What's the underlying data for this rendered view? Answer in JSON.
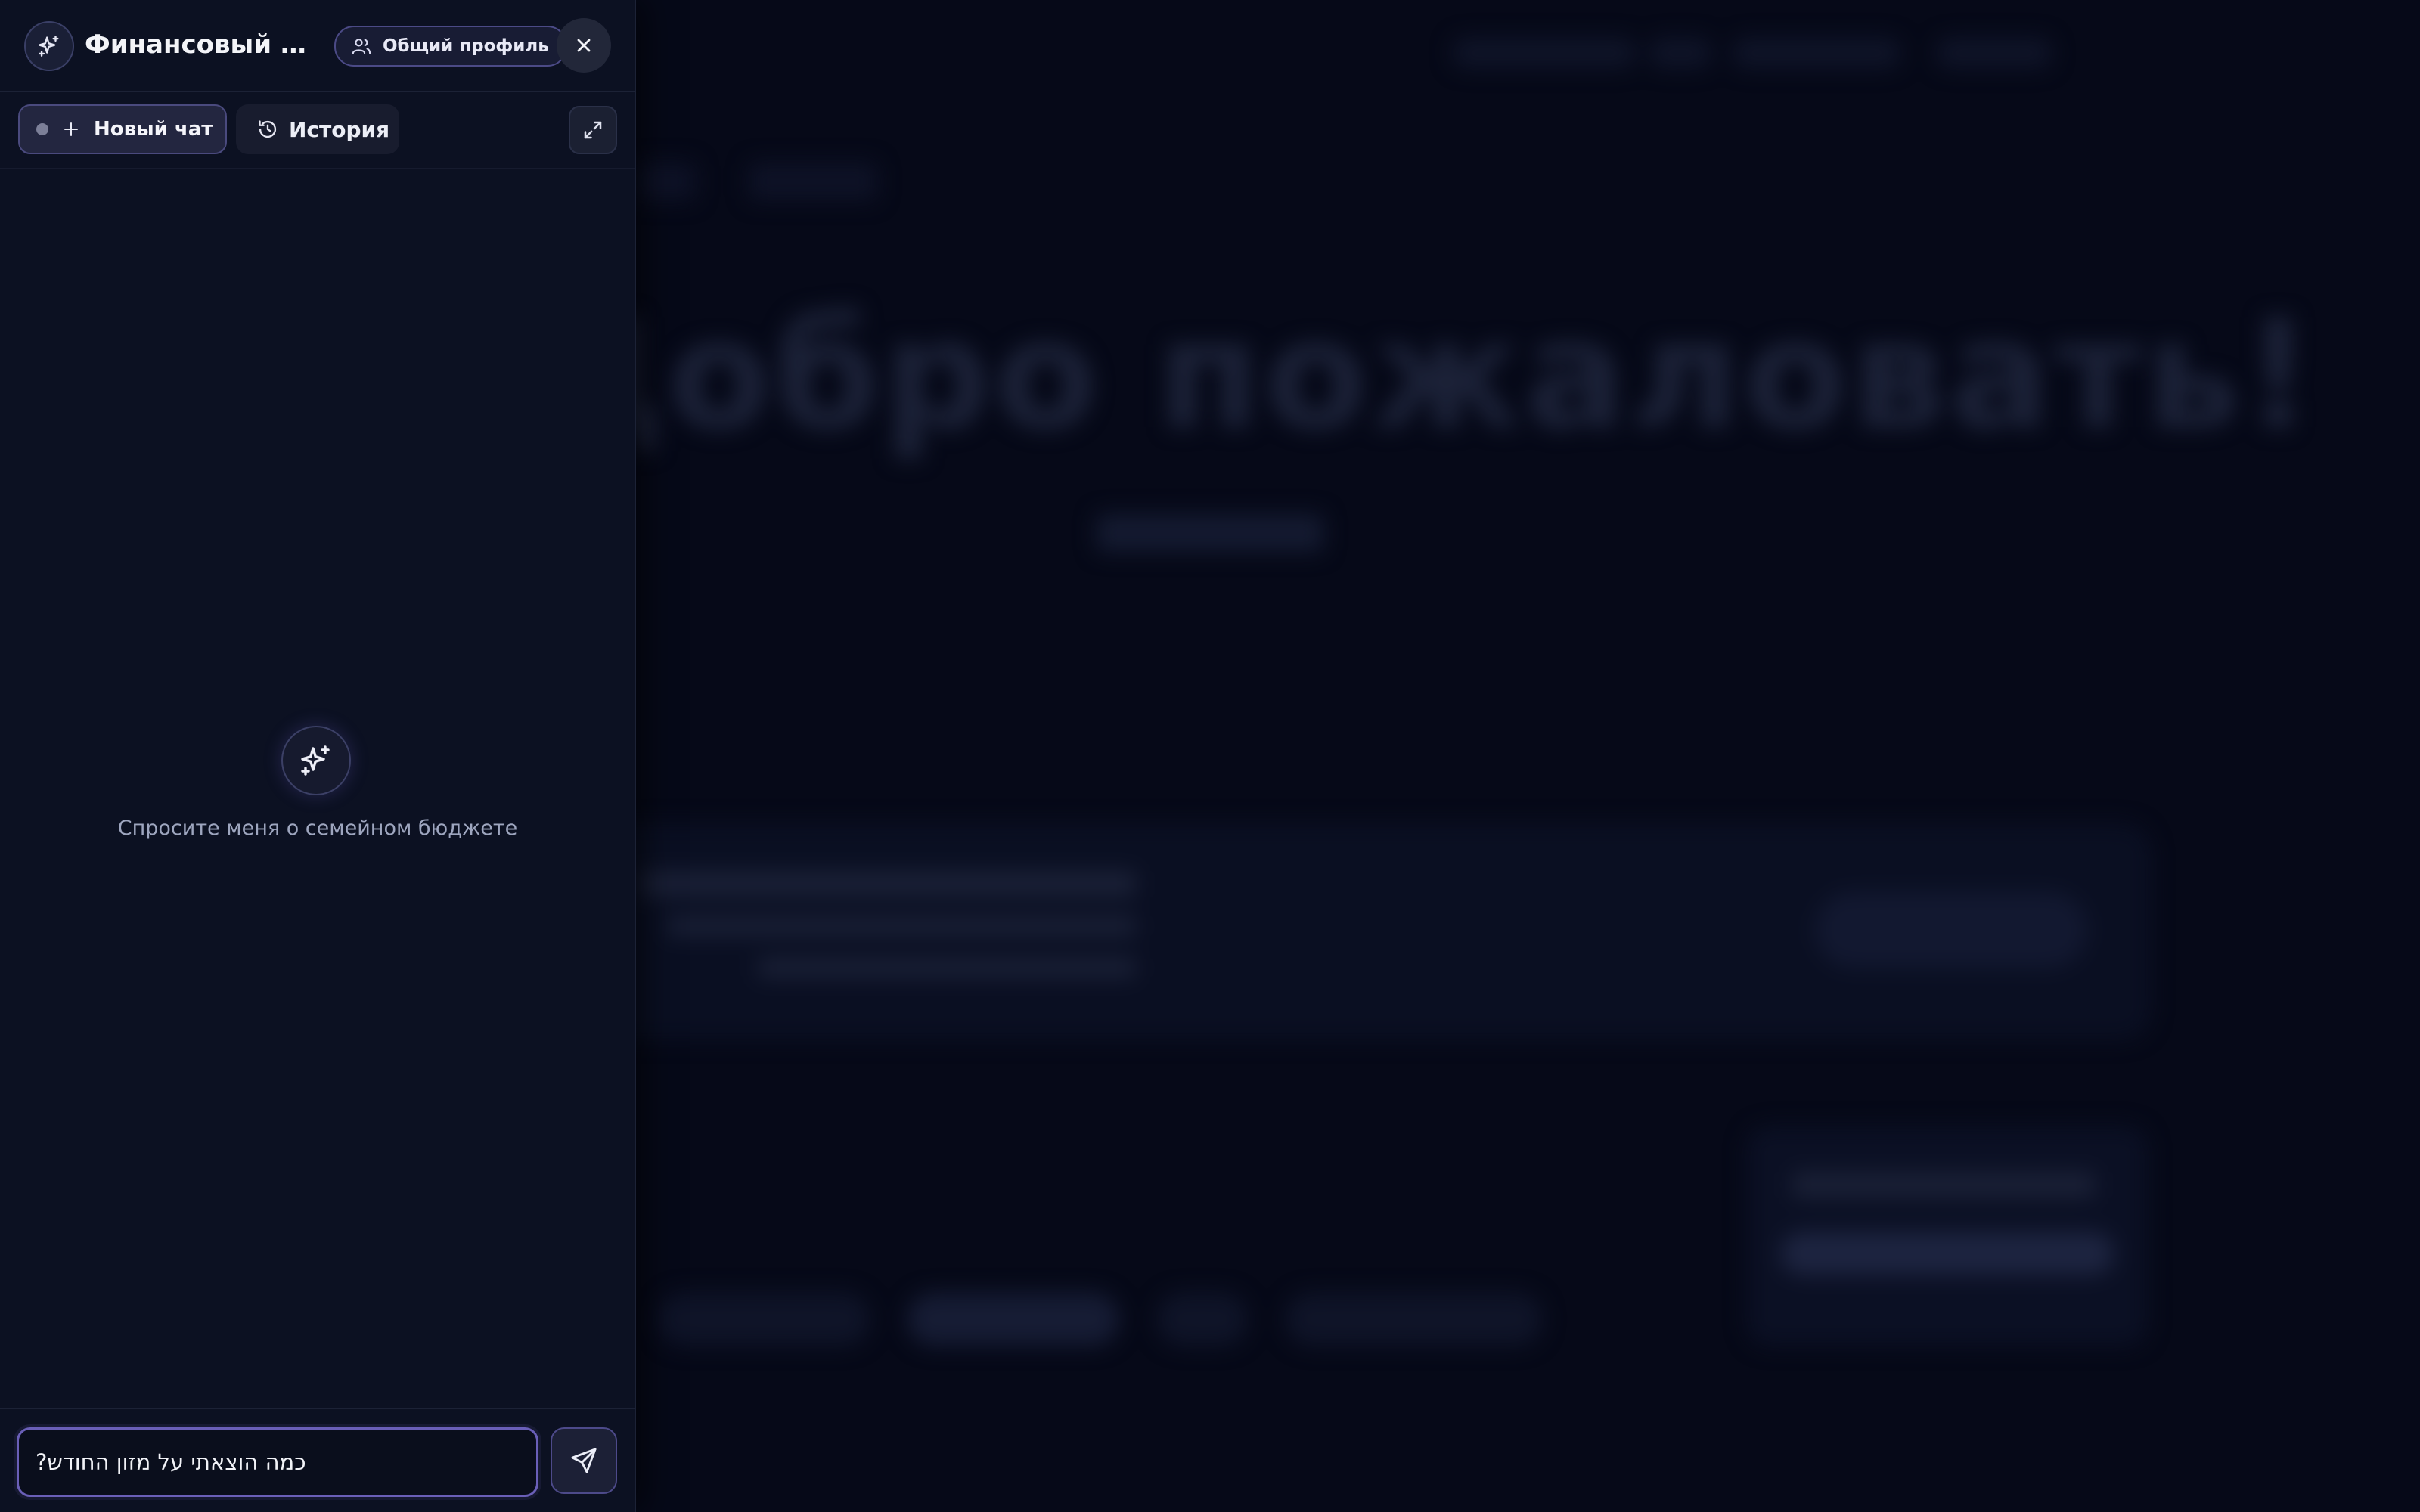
{
  "panel": {
    "title": "Финансовый кон...",
    "profile_label": "Общий профиль",
    "new_chat_label": "Новый чат",
    "history_label": "История"
  },
  "empty_state": {
    "text": "Спросите меня о семейном бюджете"
  },
  "composer": {
    "input_value": "כמה הוצאתי על מזון החודש?"
  },
  "background": {
    "hero_text": "Добро пожаловать!"
  },
  "icons": {
    "logo": "sparkles-icon",
    "profile": "users-icon",
    "close": "close-icon",
    "new_chat": "plus-icon",
    "history": "history-icon",
    "expand": "expand-icon",
    "empty": "sparkles-icon",
    "send": "send-icon"
  },
  "colors": {
    "page_bg": "#060918",
    "panel_bg": "#0c1122",
    "accent": "#6a5fb8",
    "text_primary": "#f3f4f8",
    "text_muted": "#9ea6bf"
  }
}
